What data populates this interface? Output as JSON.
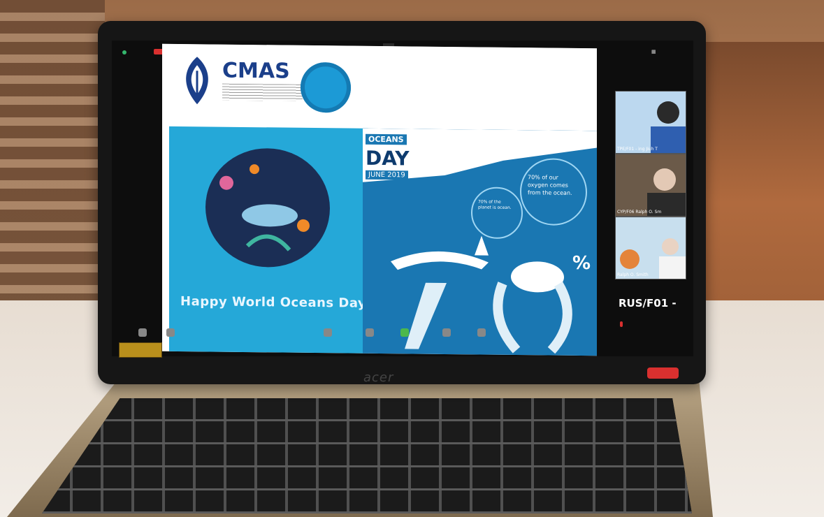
{
  "slide": {
    "logo_text": "CMAS",
    "banner_oceans": "OCEANS",
    "banner_day": "DAY",
    "banner_date": "JUNE 2019",
    "bubble_big": "70% of our oxygen comes from the ocean.",
    "bubble_small": "70% of the planet is ocean.",
    "big_percent": "%",
    "happy_text": "Happy World Oceans Day"
  },
  "participants": [
    {
      "label": "TPE/F01 - ing Jiuh T"
    },
    {
      "label": "CYP/F06 Ralph O. Sm"
    },
    {
      "label": "Ralph O. Smith"
    }
  ],
  "sidebar_user": "RUS/F01 -",
  "laptop_brand": "acer",
  "colors": {
    "accent_blue": "#25a8d8",
    "navy": "#1b2e55",
    "zoom_green": "#4cb84c",
    "leave_red": "#d9302f"
  }
}
